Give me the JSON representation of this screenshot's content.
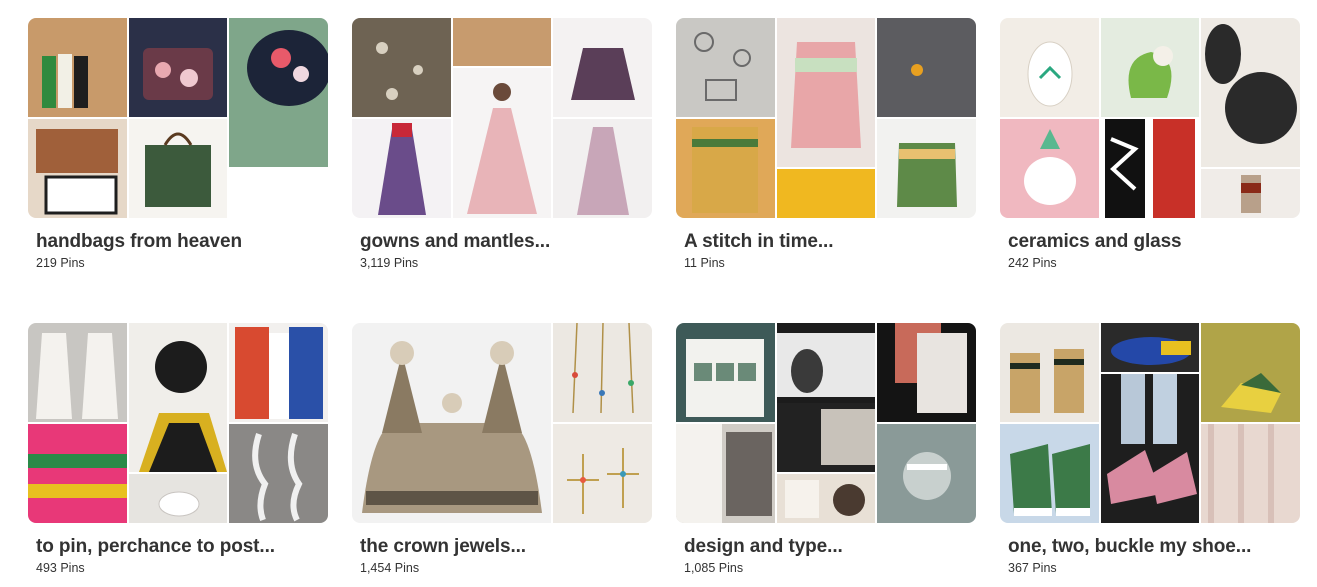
{
  "boards": [
    {
      "title": "handbags from heaven",
      "pins": "219 Pins",
      "colors": [
        "#c89a6a",
        "#2b3048",
        "#7fa68a",
        "#e6d8c8",
        "#f6f4f0",
        "#3c5a3c"
      ]
    },
    {
      "title": "gowns and mantles...",
      "pins": "3,119 Pins",
      "colors": [
        "#6e6353",
        "#c79b6e",
        "#5a3e58",
        "#6a4c8a",
        "#e8b4b8",
        "#c8a6b8"
      ]
    },
    {
      "title": "A stitch in time...",
      "pins": "11 Pins",
      "colors": [
        "#c9c8c4",
        "#e8a6a8",
        "#5c5c60",
        "#d8a848",
        "#f0b820",
        "#5e8a48"
      ]
    },
    {
      "title": "ceramics and glass",
      "pins": "242 Pins",
      "colors": [
        "#f2ede6",
        "#e4ece0",
        "#2a2a2a",
        "#f0b8c0",
        "#c83028",
        "#b8a08a"
      ]
    },
    {
      "title": "to pin, perchance to post...",
      "pins": "493 Pins",
      "colors": [
        "#c8c6c2",
        "#1c1c1c",
        "#d84a30",
        "#e83878",
        "#e6e4e0",
        "#8a8886"
      ]
    },
    {
      "title": "the crown jewels...",
      "pins": "1,454 Pins",
      "colors": [
        "#a89880",
        "#ece8e2",
        "#eeeae4"
      ]
    },
    {
      "title": "design and type...",
      "pins": "1,085 Pins",
      "colors": [
        "#3e5a58",
        "#1c1c1c",
        "#141414",
        "#d0ccc6",
        "#e8e0d6",
        "#8a9a98"
      ]
    },
    {
      "title": "one, two, buckle my shoe...",
      "pins": "367 Pins",
      "colors": [
        "#c8a468",
        "#2448a8",
        "#b0a448",
        "#3c7a48",
        "#d88aa0",
        "#e8d8d0"
      ]
    }
  ]
}
